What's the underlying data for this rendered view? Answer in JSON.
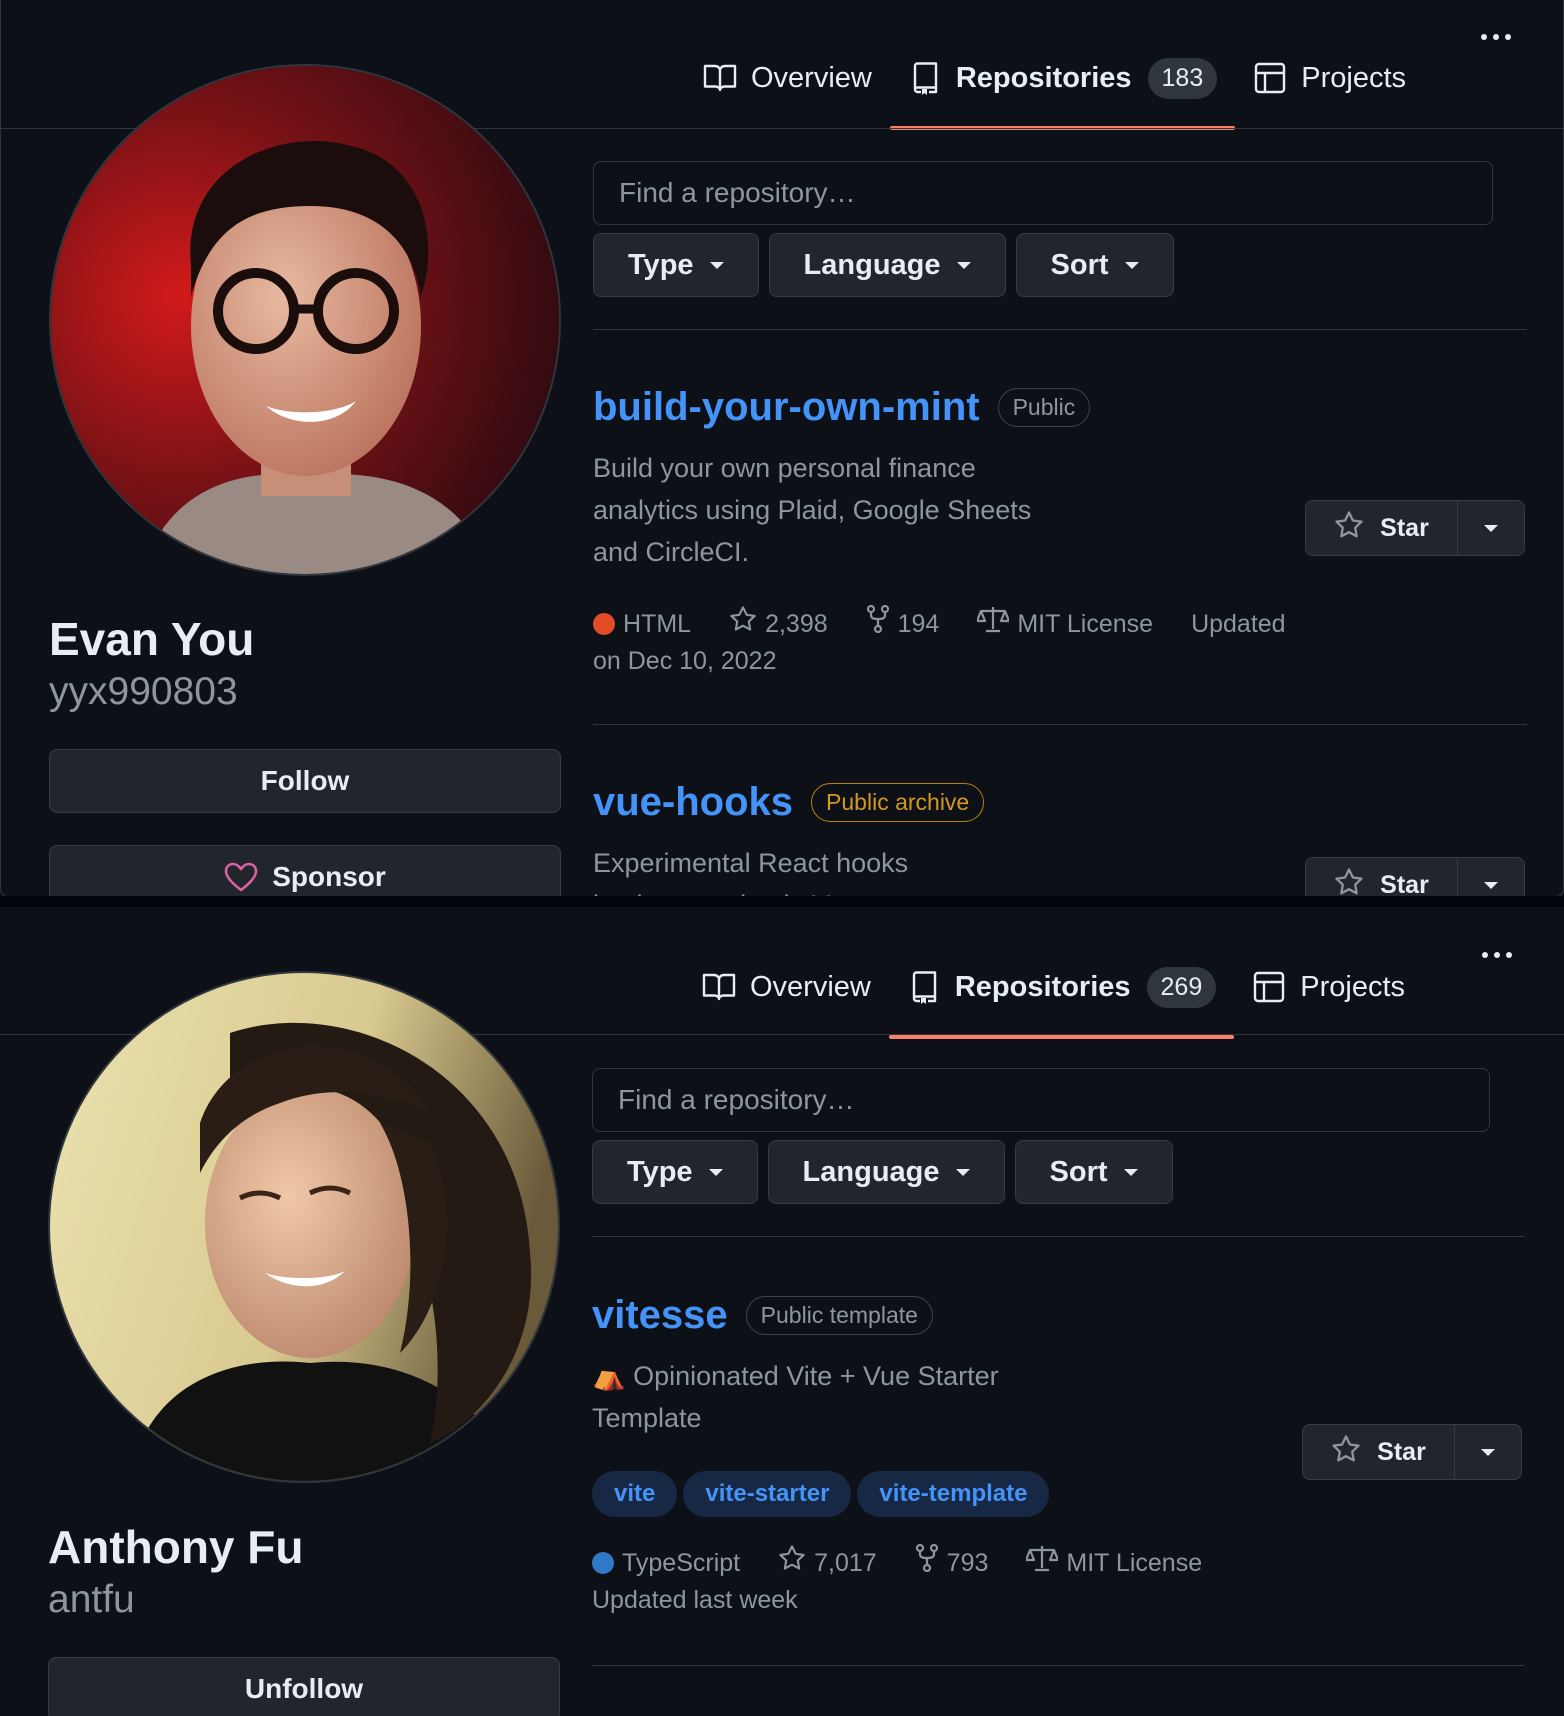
{
  "profiles": [
    {
      "tabs": {
        "overview": "Overview",
        "repositories": "Repositories",
        "repositories_count": "183",
        "projects": "Projects"
      },
      "user": {
        "name": "Evan You",
        "login": "yyx990803",
        "primary_button": "Follow",
        "sponsor_button": "Sponsor"
      },
      "search": {
        "placeholder": "Find a repository…"
      },
      "filters": {
        "type": "Type",
        "language": "Language",
        "sort": "Sort"
      },
      "repos": [
        {
          "name": "build-your-own-mint",
          "visibility": "Public",
          "description": "Build your own personal finance analytics using Plaid, Google Sheets and CircleCI.",
          "star_label": "Star",
          "language": "HTML",
          "language_color": "#e34c26",
          "stars": "2,398",
          "forks": "194",
          "license": "MIT License",
          "updated_a": "Updated",
          "updated_b": "on Dec 10, 2022"
        },
        {
          "name": "vue-hooks",
          "visibility": "Public archive",
          "description": "Experimental React hooks implementation in Vue",
          "star_label": "Star"
        }
      ]
    },
    {
      "tabs": {
        "overview": "Overview",
        "repositories": "Repositories",
        "repositories_count": "269",
        "projects": "Projects"
      },
      "user": {
        "name": "Anthony Fu",
        "login": "antfu",
        "primary_button": "Unfollow"
      },
      "search": {
        "placeholder": "Find a repository…"
      },
      "filters": {
        "type": "Type",
        "language": "Language",
        "sort": "Sort"
      },
      "repos": [
        {
          "name": "vitesse",
          "visibility": "Public template",
          "description": "⛺ Opinionated Vite + Vue Starter Template",
          "star_label": "Star",
          "topics": [
            "vite",
            "vite-starter",
            "vite-template"
          ],
          "language": "TypeScript",
          "language_color": "#3178c6",
          "stars": "7,017",
          "forks": "793",
          "license": "MIT License",
          "updated": "Updated last week"
        }
      ]
    }
  ],
  "colors": {
    "background": "#0d1117",
    "accent_tab": "#f78166",
    "link": "#4493f8",
    "archive": "#d29922",
    "sponsor_heart": "#db61a2"
  }
}
